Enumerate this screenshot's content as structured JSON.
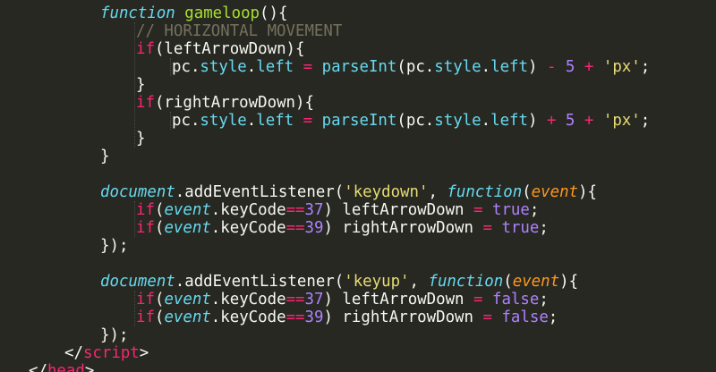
{
  "editor": {
    "theme_colors": {
      "background": "#272822",
      "foreground": "#f8f8f2",
      "keyword": "#f92672",
      "storage": "#66d9ef",
      "function": "#a6e22e",
      "string": "#e6db74",
      "number": "#ae81ff",
      "comment": "#75715e",
      "parameter": "#fd971f"
    },
    "lines": [
      {
        "indent": 2,
        "tokens": [
          [
            "storage",
            "function"
          ],
          [
            "plain",
            " "
          ],
          [
            "func",
            "gameloop"
          ],
          [
            "plain",
            "(){"
          ]
        ]
      },
      {
        "indent": 3,
        "tokens": [
          [
            "comment",
            "// HORIZONTAL MOVEMENT"
          ]
        ]
      },
      {
        "indent": 3,
        "tokens": [
          [
            "keyword",
            "if"
          ],
          [
            "plain",
            "(leftArrowDown){"
          ]
        ]
      },
      {
        "indent": 4,
        "tokens": [
          [
            "plain",
            "pc."
          ],
          [
            "builtin",
            "style"
          ],
          [
            "plain",
            "."
          ],
          [
            "builtin",
            "left"
          ],
          [
            "plain",
            " "
          ],
          [
            "keyword",
            "="
          ],
          [
            "plain",
            " "
          ],
          [
            "builtin",
            "parseInt"
          ],
          [
            "plain",
            "(pc."
          ],
          [
            "builtin",
            "style"
          ],
          [
            "plain",
            "."
          ],
          [
            "builtin",
            "left"
          ],
          [
            "plain",
            ") "
          ],
          [
            "keyword",
            "-"
          ],
          [
            "plain",
            " "
          ],
          [
            "number",
            "5"
          ],
          [
            "plain",
            " "
          ],
          [
            "keyword",
            "+"
          ],
          [
            "plain",
            " "
          ],
          [
            "string",
            "'px'"
          ],
          [
            "plain",
            ";"
          ]
        ]
      },
      {
        "indent": 3,
        "tokens": [
          [
            "plain",
            "}"
          ]
        ]
      },
      {
        "indent": 3,
        "tokens": [
          [
            "keyword",
            "if"
          ],
          [
            "plain",
            "(rightArrowDown){"
          ]
        ]
      },
      {
        "indent": 4,
        "tokens": [
          [
            "plain",
            "pc."
          ],
          [
            "builtin",
            "style"
          ],
          [
            "plain",
            "."
          ],
          [
            "builtin",
            "left"
          ],
          [
            "plain",
            " "
          ],
          [
            "keyword",
            "="
          ],
          [
            "plain",
            " "
          ],
          [
            "builtin",
            "parseInt"
          ],
          [
            "plain",
            "(pc."
          ],
          [
            "builtin",
            "style"
          ],
          [
            "plain",
            "."
          ],
          [
            "builtin",
            "left"
          ],
          [
            "plain",
            ") "
          ],
          [
            "keyword",
            "+"
          ],
          [
            "plain",
            " "
          ],
          [
            "number",
            "5"
          ],
          [
            "plain",
            " "
          ],
          [
            "keyword",
            "+"
          ],
          [
            "plain",
            " "
          ],
          [
            "string",
            "'px'"
          ],
          [
            "plain",
            ";"
          ]
        ]
      },
      {
        "indent": 3,
        "tokens": [
          [
            "plain",
            "}"
          ]
        ]
      },
      {
        "indent": 2,
        "tokens": [
          [
            "plain",
            "}"
          ]
        ]
      },
      {
        "indent": 0,
        "tokens": []
      },
      {
        "indent": 2,
        "tokens": [
          [
            "var",
            "document"
          ],
          [
            "plain",
            ".addEventListener("
          ],
          [
            "string",
            "'keydown'"
          ],
          [
            "plain",
            ", "
          ],
          [
            "storage",
            "function"
          ],
          [
            "plain",
            "("
          ],
          [
            "param",
            "event"
          ],
          [
            "plain",
            "){"
          ]
        ]
      },
      {
        "indent": 3,
        "tokens": [
          [
            "keyword",
            "if"
          ],
          [
            "plain",
            "("
          ],
          [
            "var",
            "event"
          ],
          [
            "plain",
            ".keyCode"
          ],
          [
            "keyword",
            "=="
          ],
          [
            "number",
            "37"
          ],
          [
            "plain",
            ") leftArrowDown "
          ],
          [
            "keyword",
            "="
          ],
          [
            "plain",
            " "
          ],
          [
            "const",
            "true"
          ],
          [
            "plain",
            ";"
          ]
        ]
      },
      {
        "indent": 3,
        "tokens": [
          [
            "keyword",
            "if"
          ],
          [
            "plain",
            "("
          ],
          [
            "var",
            "event"
          ],
          [
            "plain",
            ".keyCode"
          ],
          [
            "keyword",
            "=="
          ],
          [
            "number",
            "39"
          ],
          [
            "plain",
            ") rightArrowDown "
          ],
          [
            "keyword",
            "="
          ],
          [
            "plain",
            " "
          ],
          [
            "const",
            "true"
          ],
          [
            "plain",
            ";"
          ]
        ]
      },
      {
        "indent": 2,
        "tokens": [
          [
            "plain",
            "});"
          ]
        ]
      },
      {
        "indent": 0,
        "tokens": []
      },
      {
        "indent": 2,
        "tokens": [
          [
            "var",
            "document"
          ],
          [
            "plain",
            ".addEventListener("
          ],
          [
            "string",
            "'keyup'"
          ],
          [
            "plain",
            ", "
          ],
          [
            "storage",
            "function"
          ],
          [
            "plain",
            "("
          ],
          [
            "param",
            "event"
          ],
          [
            "plain",
            "){"
          ]
        ]
      },
      {
        "indent": 3,
        "tokens": [
          [
            "keyword",
            "if"
          ],
          [
            "plain",
            "("
          ],
          [
            "var",
            "event"
          ],
          [
            "plain",
            ".keyCode"
          ],
          [
            "keyword",
            "=="
          ],
          [
            "number",
            "37"
          ],
          [
            "plain",
            ") leftArrowDown "
          ],
          [
            "keyword",
            "="
          ],
          [
            "plain",
            " "
          ],
          [
            "const",
            "false"
          ],
          [
            "plain",
            ";"
          ]
        ]
      },
      {
        "indent": 3,
        "tokens": [
          [
            "keyword",
            "if"
          ],
          [
            "plain",
            "("
          ],
          [
            "var",
            "event"
          ],
          [
            "plain",
            ".keyCode"
          ],
          [
            "keyword",
            "=="
          ],
          [
            "number",
            "39"
          ],
          [
            "plain",
            ") rightArrowDown "
          ],
          [
            "keyword",
            "="
          ],
          [
            "plain",
            " "
          ],
          [
            "const",
            "false"
          ],
          [
            "plain",
            ";"
          ]
        ]
      },
      {
        "indent": 2,
        "tokens": [
          [
            "plain",
            "});"
          ]
        ]
      },
      {
        "indent": 1,
        "tokens": [
          [
            "plain",
            "</"
          ],
          [
            "tag",
            "script"
          ],
          [
            "plain",
            ">"
          ]
        ]
      },
      {
        "indent": 0,
        "tokens": [
          [
            "plain",
            "</"
          ],
          [
            "tag",
            "head"
          ],
          [
            "plain",
            ">"
          ]
        ]
      }
    ]
  }
}
